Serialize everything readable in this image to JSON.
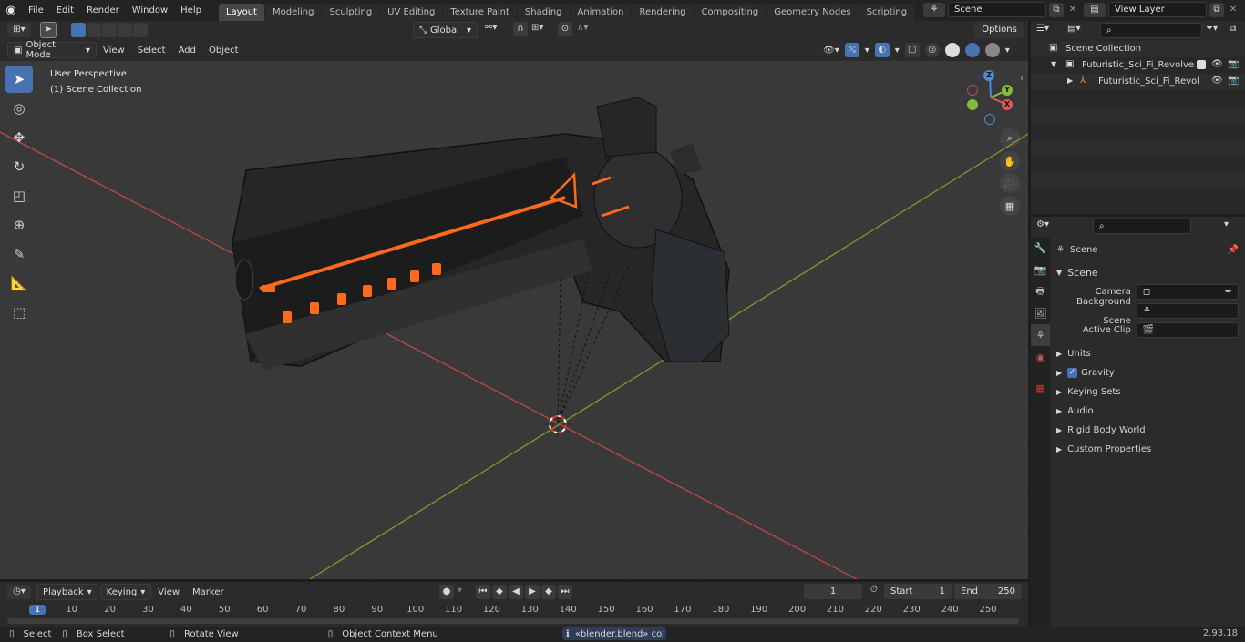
{
  "topbar": {
    "menus": [
      "File",
      "Edit",
      "Render",
      "Window",
      "Help"
    ],
    "workspaces": [
      "Layout",
      "Modeling",
      "Sculpting",
      "UV Editing",
      "Texture Paint",
      "Shading",
      "Animation",
      "Rendering",
      "Compositing",
      "Geometry Nodes",
      "Scripting"
    ],
    "active_workspace": "Layout",
    "scene": "Scene",
    "view_layer": "View Layer"
  },
  "toolheader": {
    "orientation": "Global",
    "options": "Options"
  },
  "viewport_header": {
    "mode": "Object Mode",
    "menus": [
      "View",
      "Select",
      "Add",
      "Object"
    ]
  },
  "viewport": {
    "perspective": "User Perspective",
    "collection": "(1) Scene Collection"
  },
  "gizmo": {
    "x": "X",
    "y": "Y",
    "z": "Z"
  },
  "outliner": {
    "root": "Scene Collection",
    "items": [
      "Futuristic_Sci_Fi_Revolver_Pis",
      "Futuristic_Sci_Fi_Revolve"
    ]
  },
  "properties": {
    "context": "Scene",
    "panel": "Scene",
    "fields": [
      {
        "label": "Camera"
      },
      {
        "label": "Background Scene"
      },
      {
        "label": "Active Clip"
      }
    ],
    "sections": [
      "Units",
      "Gravity",
      "Keying Sets",
      "Audio",
      "Rigid Body World",
      "Custom Properties"
    ]
  },
  "timeline": {
    "menus": [
      "Playback",
      "Keying",
      "View",
      "Marker"
    ],
    "current_frame": "1",
    "start_label": "Start",
    "start": "1",
    "end_label": "End",
    "end": "250",
    "ticks": [
      "1",
      "10",
      "20",
      "30",
      "40",
      "50",
      "60",
      "70",
      "80",
      "90",
      "100",
      "110",
      "120",
      "130",
      "140",
      "150",
      "160",
      "170",
      "180",
      "190",
      "200",
      "210",
      "220",
      "230",
      "240",
      "250"
    ]
  },
  "statusbar": {
    "select": "Select",
    "box_select": "Box Select",
    "rotate": "Rotate View",
    "context": "Object Context Menu",
    "notification": "«blender.blend» cox...",
    "version": "2.93.18"
  },
  "colors": {
    "accent": "#4772b3",
    "x_axis": "#e05a5a",
    "y_axis": "#87b93a",
    "z_axis": "#4a8ce0",
    "glow": "#ff6a1a"
  }
}
